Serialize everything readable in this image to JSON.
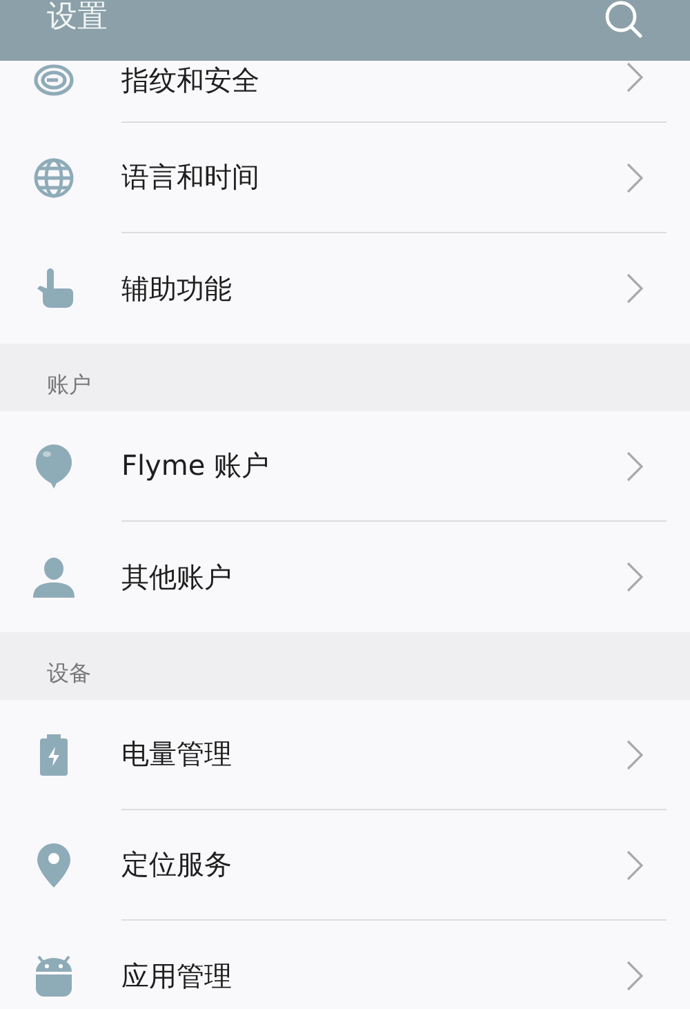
{
  "header": {
    "title": "设置"
  },
  "sections": [
    {
      "items": [
        {
          "kind": "fingerprint",
          "label": "指纹和安全"
        },
        {
          "kind": "globe",
          "label": "语言和时间"
        },
        {
          "kind": "hand",
          "label": "辅助功能"
        }
      ]
    },
    {
      "title": "账户",
      "items": [
        {
          "kind": "balloon",
          "label": "Flyme 账户"
        },
        {
          "kind": "person",
          "label": "其他账户"
        }
      ]
    },
    {
      "title": "设备",
      "items": [
        {
          "kind": "battery",
          "label": "电量管理"
        },
        {
          "kind": "pin",
          "label": "定位服务"
        },
        {
          "kind": "robot",
          "label": "应用管理"
        }
      ]
    }
  ]
}
